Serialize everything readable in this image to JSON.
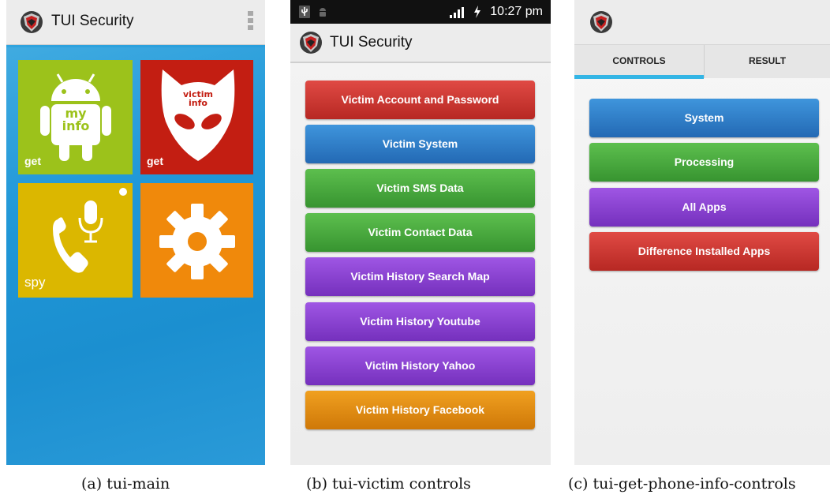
{
  "panel_a": {
    "title": "TUI Security",
    "caption": "(a) tui-main",
    "tiles": [
      {
        "id": "my-info",
        "label": "get",
        "icon_text_1": "my",
        "icon_text_2": "info",
        "color": "#9cc21b"
      },
      {
        "id": "victim-info",
        "label": "get",
        "icon_text_1": "victim",
        "icon_text_2": "info",
        "color": "#c31e12"
      },
      {
        "id": "spy",
        "label": "spy",
        "color": "#dbb700"
      },
      {
        "id": "settings",
        "label": "",
        "color": "#f0890b"
      }
    ]
  },
  "panel_b": {
    "status_time": "10:27 pm",
    "title": "TUI Security",
    "caption": "(b) tui-victim controls",
    "buttons": [
      {
        "label": "Victim Account and Password",
        "color": "red"
      },
      {
        "label": "Victim System",
        "color": "blue"
      },
      {
        "label": "Victim SMS Data",
        "color": "green"
      },
      {
        "label": "Victim Contact Data",
        "color": "green"
      },
      {
        "label": "Victim History Search Map",
        "color": "purple"
      },
      {
        "label": "Victim History Youtube",
        "color": "purple"
      },
      {
        "label": "Victim History Yahoo",
        "color": "purple"
      },
      {
        "label": "Victim History Facebook",
        "color": "orange"
      }
    ]
  },
  "panel_c": {
    "caption": "(c) tui-get-phone-info-controls",
    "tabs": [
      "CONTROLS",
      "RESULT"
    ],
    "active_tab": "CONTROLS",
    "buttons": [
      {
        "label": "System",
        "color": "blue"
      },
      {
        "label": "Processing",
        "color": "green"
      },
      {
        "label": "All Apps",
        "color": "purple"
      },
      {
        "label": "Difference Installed Apps",
        "color": "red"
      }
    ]
  },
  "colors": {
    "red": "#c9302c",
    "blue": "#2f7fc8",
    "green": "#48a83c",
    "purple": "#8a3dd0",
    "orange": "#e08a10",
    "tab_accent": "#33b5e5"
  }
}
